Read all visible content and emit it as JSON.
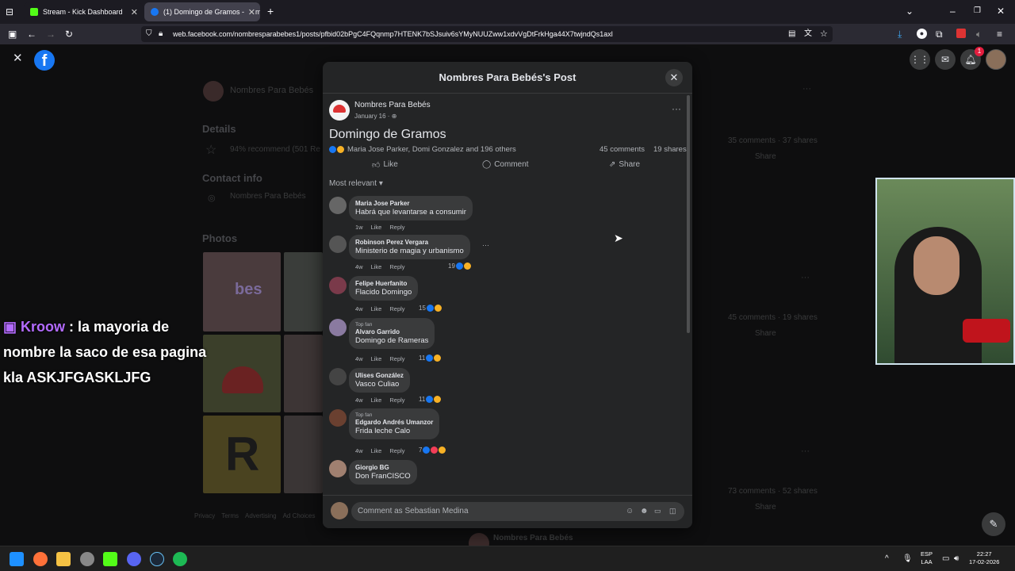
{
  "browser": {
    "tabs": [
      {
        "title": "Stream - Kick Dashboard",
        "active": false
      },
      {
        "title": "(1) Domingo de Gramos - Nom",
        "active": true
      }
    ],
    "url": "web.facebook.com/nombresparabebes1/posts/pfbid02bPgC4FQqnmp7HTENK7bSJsuiv6sYMyNUUZww1xdvVgDtFrkHga44X7twjndQs1axl"
  },
  "facebook_nav": {
    "notifications_count": "1"
  },
  "background_page": {
    "page_name": "Nombres Para Bebés",
    "details_heading": "Details",
    "recommend_text": "94% recommend (501 Re",
    "contact_heading": "Contact info",
    "contact_name": "Nombres Para Bebés",
    "photos_heading": "Photos",
    "footer_links": [
      "Privacy",
      "Terms",
      "Advertising",
      "Ad Choices"
    ],
    "post1_stats": "35 comments · 37 shares",
    "post2_stats": "45 comments · 19 shares",
    "post3_stats": "73 comments · 52 shares",
    "share_label": "Share",
    "bottom_page_name": "Nombres Para Bebés",
    "photo_text_1": "bes",
    "photo_text_2": "R"
  },
  "modal": {
    "title": "Nombres Para Bebés's Post",
    "author": "Nombres Para Bebés",
    "date": "January 16 ·",
    "post_text": "Domingo de Gramos",
    "reactions_text": "Maria Jose Parker, Domi Gonzalez and 196 others",
    "comments_count": "45 comments",
    "shares_count": "19 shares",
    "actions": {
      "like": "Like",
      "comment": "Comment",
      "share": "Share"
    },
    "sort_label": "Most relevant",
    "comments": [
      {
        "name": "Maria Jose Parker",
        "text": "Habrá que levantarse a consumir",
        "time": "1w",
        "reactions": "",
        "top_fan": ""
      },
      {
        "name": "Robinson Perez Vergara",
        "text": "Ministerio de magia y urbanismo",
        "time": "4w",
        "reactions": "19",
        "top_fan": ""
      },
      {
        "name": "Felipe Huerfanito",
        "text": "Flacido Domingo",
        "time": "4w",
        "reactions": "15",
        "top_fan": ""
      },
      {
        "name": "Alvaro Garrido",
        "text": "Domingo de Rameras",
        "time": "4w",
        "reactions": "11",
        "top_fan": "Top fan"
      },
      {
        "name": "Ulises González",
        "text": "Vasco Culiao",
        "time": "4w",
        "reactions": "11",
        "top_fan": ""
      },
      {
        "name": "Edgardo Andrés Umanzor",
        "text": "Frida leche Calo",
        "time": "4w",
        "reactions": "7",
        "top_fan": "Top fan"
      },
      {
        "name": "Giorgio BG",
        "text": "Don FranCISCO",
        "time": "4w",
        "reactions": "",
        "top_fan": ""
      }
    ],
    "comment_like": "Like",
    "comment_reply": "Reply",
    "compose_placeholder": "Comment as Sebastian Medina"
  },
  "stream_overlay": {
    "chat_user": "Kroow",
    "chat_message": " : la mayoria de nombre la saco de esa pagina kla ASKJFGASKLJFG"
  },
  "taskbar": {
    "language": "ESP",
    "layout": "LAA",
    "time": "22:27",
    "date": "17-02-2026"
  },
  "colors": {
    "fb_blue": "#1877f2",
    "kick_green": "#53fc18",
    "chat_user_color": "#b36bff"
  }
}
